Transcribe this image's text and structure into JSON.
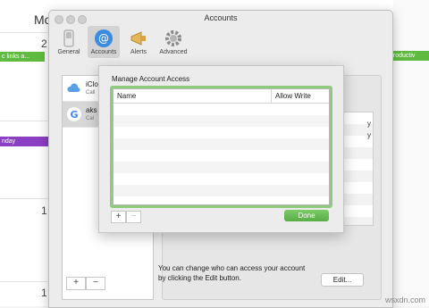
{
  "background": {
    "header_partial": "Mo",
    "day_numbers": [
      "2",
      "1",
      "1"
    ],
    "events": {
      "left_green": "c links a...",
      "right_green": "productiv",
      "purple": "nday"
    }
  },
  "window": {
    "title": "Accounts",
    "toolbar": [
      {
        "label": "General",
        "icon": "switch-icon"
      },
      {
        "label": "Accounts",
        "icon": "at-icon",
        "active": true
      },
      {
        "label": "Alerts",
        "icon": "megaphone-icon"
      },
      {
        "label": "Advanced",
        "icon": "gear-icon"
      }
    ],
    "accounts": [
      {
        "name": "iClo",
        "sub": "Call",
        "icon": "icloud-icon"
      },
      {
        "name": "aks",
        "sub": "Cal",
        "icon": "google-icon",
        "selected": true
      }
    ],
    "list_add": "+",
    "list_remove": "−",
    "detail_values": [
      "y",
      "y"
    ],
    "help_text": "You can change who can access your account by clicking the Edit button.",
    "edit_label": "Edit..."
  },
  "sheet": {
    "title": "Manage Account Access",
    "columns": [
      "Name",
      "Allow Write"
    ],
    "add_label": "+",
    "remove_label": "−",
    "done_label": "Done"
  },
  "watermark": "wsxdn.com",
  "colors": {
    "accent_green": "#5fbb3f",
    "focus_ring": "#8fca7f",
    "purple_event": "#8a3fc4"
  }
}
